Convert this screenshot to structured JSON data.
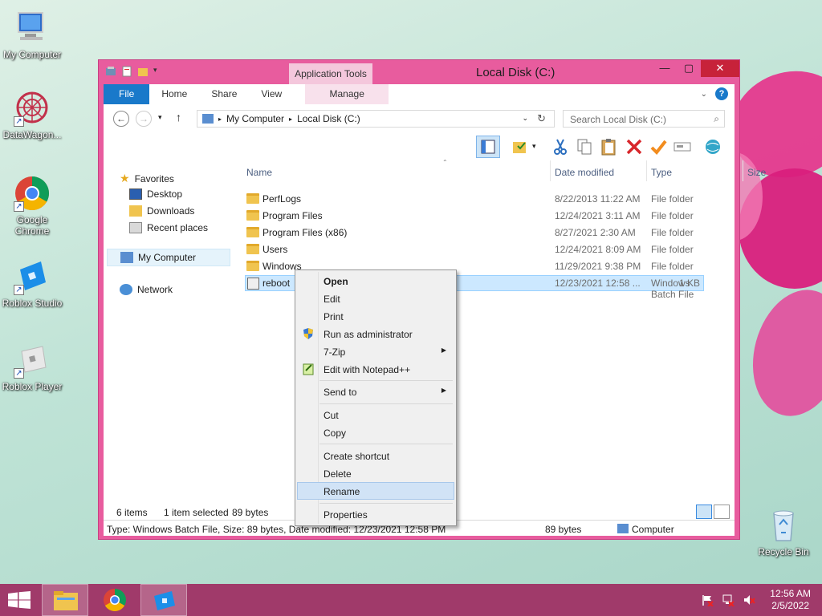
{
  "desktop": {
    "icons": [
      {
        "label": "My Computer"
      },
      {
        "label": "DataWagon..."
      },
      {
        "label": "Google Chrome"
      },
      {
        "label": "Roblox Studio"
      },
      {
        "label": "Roblox Player"
      },
      {
        "label": "Recycle Bin"
      }
    ]
  },
  "window": {
    "title": "Local Disk (C:)",
    "context_tab_group": "Application Tools",
    "tabs": {
      "file": "File",
      "home": "Home",
      "share": "Share",
      "view": "View",
      "manage": "Manage"
    },
    "buttons": {
      "minimize": "—",
      "maximize": "▢",
      "close": "✕"
    }
  },
  "address": {
    "crumbs": [
      "My Computer",
      "Local Disk (C:)"
    ],
    "search_placeholder": "Search Local Disk (C:)"
  },
  "navigation": {
    "favorites": "Favorites",
    "favorites_items": [
      "Desktop",
      "Downloads",
      "Recent places"
    ],
    "computer": "My Computer",
    "network": "Network"
  },
  "columns": {
    "name": "Name",
    "date": "Date modified",
    "type": "Type",
    "size": "Size"
  },
  "files": [
    {
      "name": "PerfLogs",
      "date": "8/22/2013 11:22 AM",
      "type": "File folder",
      "size": ""
    },
    {
      "name": "Program Files",
      "date": "12/24/2021 3:11 AM",
      "type": "File folder",
      "size": ""
    },
    {
      "name": "Program Files (x86)",
      "date": "8/27/2021 2:30 AM",
      "type": "File folder",
      "size": ""
    },
    {
      "name": "Users",
      "date": "12/24/2021 8:09 AM",
      "type": "File folder",
      "size": ""
    },
    {
      "name": "Windows",
      "date": "11/29/2021 9:38 PM",
      "type": "File folder",
      "size": ""
    },
    {
      "name": "reboot",
      "date": "12/23/2021 12:58 ...",
      "type": "Windows Batch File",
      "size": "1 KB"
    }
  ],
  "status": {
    "items": "6 items",
    "selected": "1 item selected",
    "bytes": "89 bytes",
    "details": "Type: Windows Batch File, Size: 89 bytes, Date modified: 12/23/2021 12:58 PM",
    "size_right": "89 bytes",
    "location": "Computer"
  },
  "context_menu": {
    "open": "Open",
    "edit": "Edit",
    "print": "Print",
    "run_admin": "Run as administrator",
    "zip": "7-Zip",
    "notepad": "Edit with Notepad++",
    "send_to": "Send to",
    "cut": "Cut",
    "copy": "Copy",
    "create_shortcut": "Create shortcut",
    "delete": "Delete",
    "rename": "Rename",
    "properties": "Properties"
  },
  "taskbar": {
    "time": "12:56 AM",
    "date": "2/5/2022"
  },
  "colors": {
    "window_frame": "#e85c9e",
    "taskbar": "#a03a6a",
    "file_tab": "#1979ca",
    "selection": "#cce8ff",
    "menu_hover": "#d1e3f6"
  }
}
